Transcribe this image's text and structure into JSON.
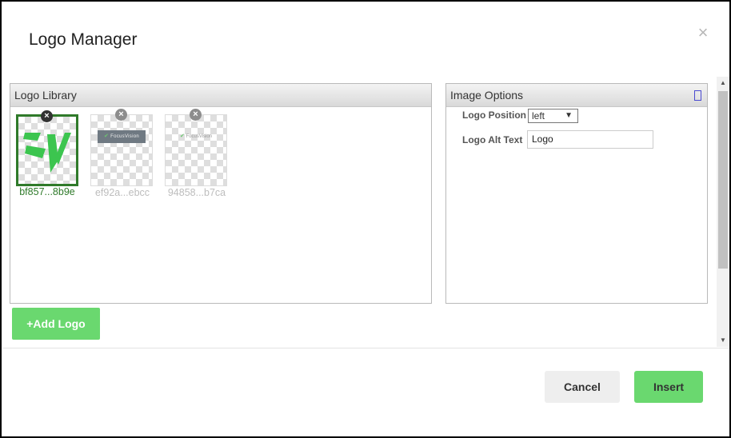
{
  "dialog": {
    "title": "Logo Manager",
    "close_label": "×"
  },
  "library": {
    "header": "Logo Library",
    "logos": [
      {
        "caption": "bf857...8b9e",
        "selected": true,
        "delete_label": "×"
      },
      {
        "caption": "ef92a...ebcc",
        "selected": false,
        "delete_label": "×",
        "brand": "FocusVision"
      },
      {
        "caption": "94858...b7ca",
        "selected": false,
        "delete_label": "×",
        "brand": "FocusVision"
      }
    ],
    "add_button": "+Add Logo"
  },
  "options": {
    "header": "Image Options",
    "position_label": "Logo Position",
    "position_value": "left",
    "position_arrow": "▼",
    "alt_label": "Logo Alt Text",
    "alt_value": "Logo"
  },
  "scroll": {
    "up": "▲",
    "down": "▼"
  },
  "footer": {
    "cancel": "Cancel",
    "insert": "Insert"
  },
  "colors": {
    "accent_green": "#6ad86f",
    "selected_border": "#2f7a2a",
    "logo_green": "#3cc54f"
  }
}
